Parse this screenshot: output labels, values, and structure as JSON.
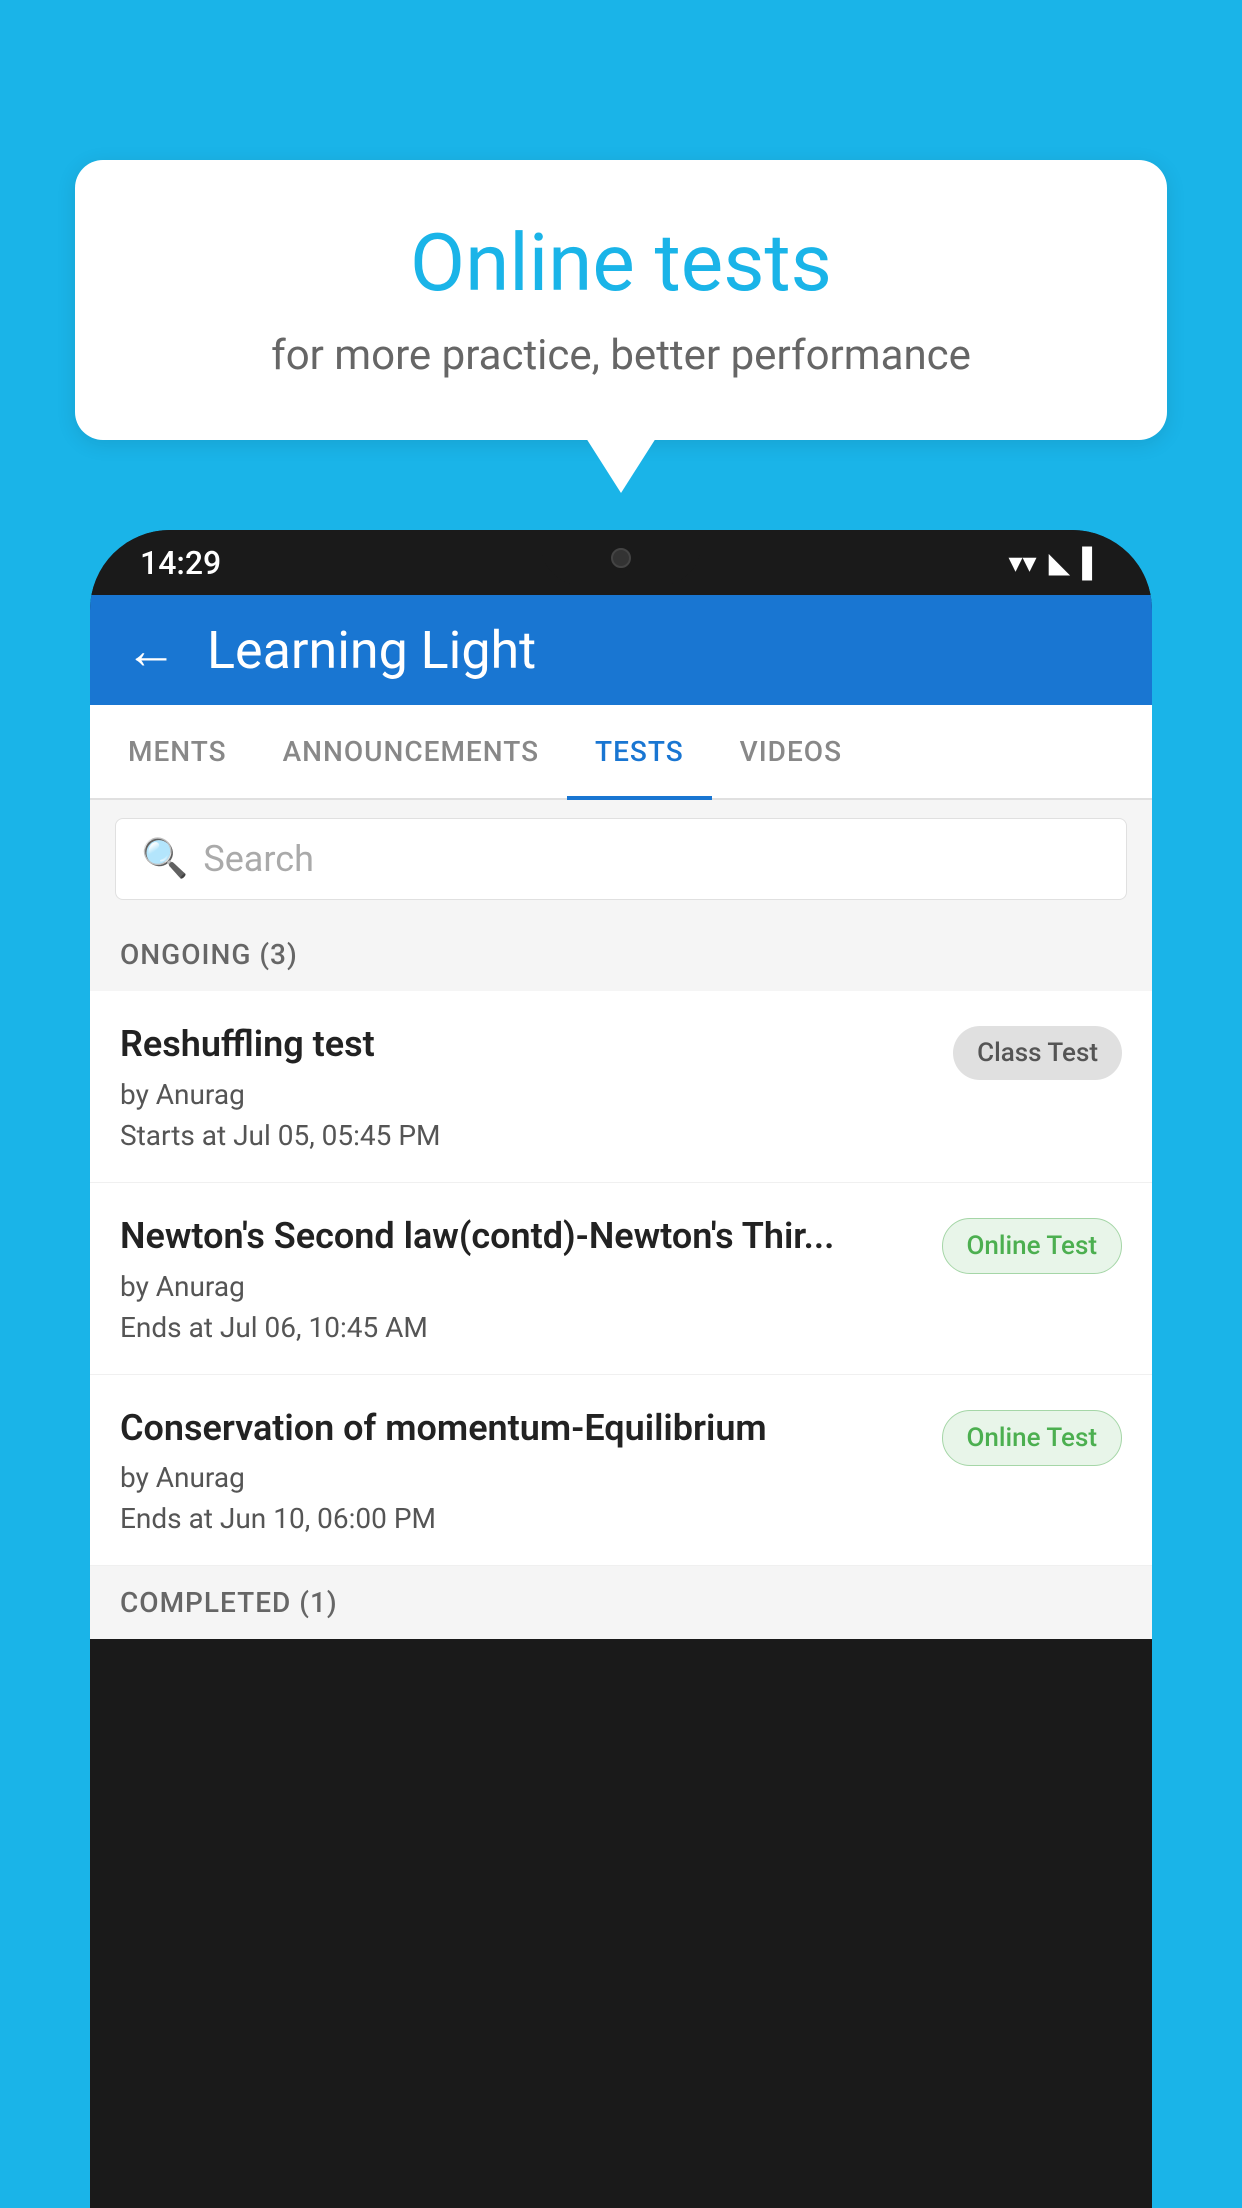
{
  "background_color": "#1ab4e8",
  "speech_bubble": {
    "title": "Online tests",
    "subtitle": "for more practice, better performance"
  },
  "phone": {
    "time": "14:29",
    "status_icons": [
      "wifi",
      "signal",
      "battery"
    ]
  },
  "app_bar": {
    "title": "Learning Light",
    "back_label": "←"
  },
  "tabs": [
    {
      "label": "MENTS",
      "active": false
    },
    {
      "label": "ANNOUNCEMENTS",
      "active": false
    },
    {
      "label": "TESTS",
      "active": true
    },
    {
      "label": "VIDEOS",
      "active": false
    }
  ],
  "search": {
    "placeholder": "Search"
  },
  "ongoing_section": {
    "label": "ONGOING (3)"
  },
  "test_items": [
    {
      "title": "Reshuffling test",
      "author": "by Anurag",
      "date_label": "Starts at",
      "date": "Jul 05, 05:45 PM",
      "badge": "Class Test",
      "badge_type": "class"
    },
    {
      "title": "Newton's Second law(contd)-Newton's Thir...",
      "author": "by Anurag",
      "date_label": "Ends at",
      "date": "Jul 06, 10:45 AM",
      "badge": "Online Test",
      "badge_type": "online"
    },
    {
      "title": "Conservation of momentum-Equilibrium",
      "author": "by Anurag",
      "date_label": "Ends at",
      "date": "Jun 10, 06:00 PM",
      "badge": "Online Test",
      "badge_type": "online"
    }
  ],
  "completed_section": {
    "label": "COMPLETED (1)"
  }
}
